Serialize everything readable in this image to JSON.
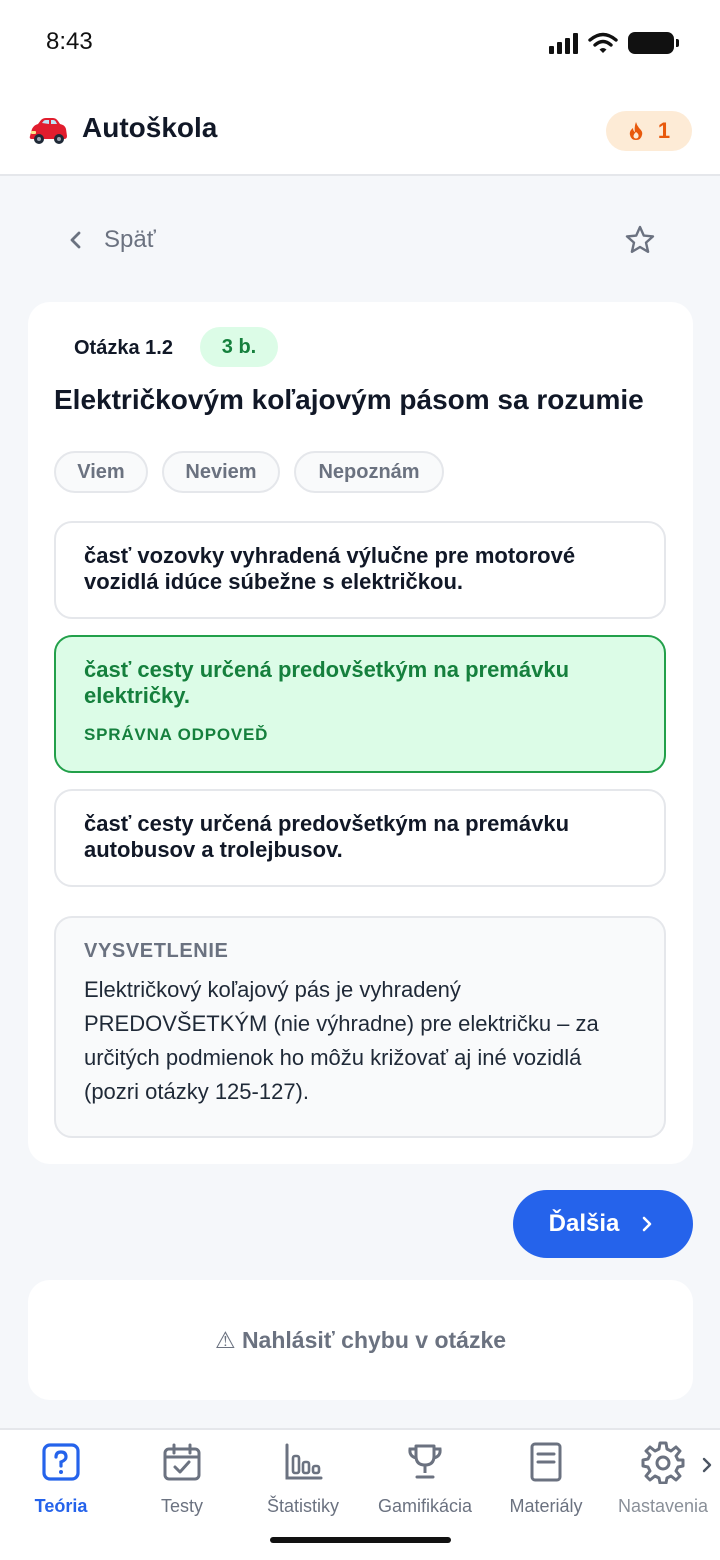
{
  "status_bar": {
    "time": "8:43"
  },
  "header": {
    "app_name": "Autoškola",
    "logo_icon": "car-icon",
    "streak_icon": "flame-icon",
    "streak_count": "1"
  },
  "nav_row": {
    "back_label": "Späť",
    "favorite_icon": "star-icon"
  },
  "question": {
    "number": "Otázka 1.2",
    "points": "3 b.",
    "title": "Električkovým koľajovým pásom sa rozumie",
    "knowledge_chips": [
      "Viem",
      "Neviem",
      "Nepoznám"
    ],
    "answers": [
      {
        "text": "časť vozovky vyhradená výlučne pre motorové vozidlá idúce súbežne s električkou.",
        "state": "default"
      },
      {
        "text": "časť cesty určená predovšetkým na premávku električky.",
        "state": "correct",
        "label": "SPRÁVNA ODPOVEĎ"
      },
      {
        "text": "časť cesty určená predovšetkým na premávku autobusov a trolejbusov.",
        "state": "default"
      }
    ],
    "explanation": {
      "title": "VYSVETLENIE",
      "text": "Električkový koľajový pás je vyhradený PREDOVŠETKÝM (nie výhradne) pre električku – za určitých podmienok ho môžu križovať aj iné vozidlá (pozri otázky 125-127)."
    }
  },
  "actions": {
    "next_label": "Ďalšia",
    "report_label": "⚠ Nahlásiť chybu v otázke"
  },
  "bottom_nav": {
    "items": [
      {
        "label": "Teória",
        "icon": "question-icon",
        "active": true
      },
      {
        "label": "Testy",
        "icon": "calendar-check-icon",
        "active": false
      },
      {
        "label": "Štatistiky",
        "icon": "bar-chart-icon",
        "active": false
      },
      {
        "label": "Gamifikácia",
        "icon": "trophy-icon",
        "active": false
      },
      {
        "label": "Materiály",
        "icon": "document-icon",
        "active": false
      },
      {
        "label": "Nastavenia",
        "icon": "gear-icon",
        "active": false
      }
    ]
  },
  "colors": {
    "primary": "#2563eb",
    "correct": "#15803d",
    "correct_bg": "#dcfce7",
    "streak": "#e8590c"
  }
}
